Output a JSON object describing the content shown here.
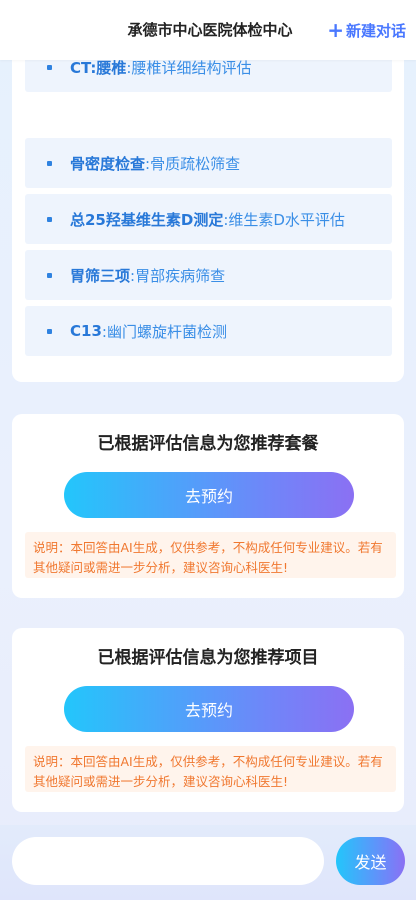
{
  "header": {
    "title": "承德市中心医院体检中心",
    "new_chat_icon": "plus-icon",
    "new_chat_label": "新建对话"
  },
  "items": [
    {
      "name": "CT:腰椎",
      "desc": ":腰椎详细结构评估"
    },
    {
      "name": "骨密度检查",
      "desc": ":骨质疏松筛查"
    },
    {
      "name": "总25羟基维生素D测定",
      "desc": ":维生素D水平评估"
    },
    {
      "name": "胃筛三项",
      "desc": ":胃部疾病筛查"
    },
    {
      "name": "C13",
      "desc": ":幽门螺旋杆菌检测"
    }
  ],
  "recommend_package": {
    "title": "已根据评估信息为您推荐套餐",
    "button": "去预约",
    "notice": "说明：本回答由AI生成，仅供参考，不构成任何专业建议。若有其他疑问或需进一步分析，建议咨询心科医生!"
  },
  "recommend_item": {
    "title": "已根据评估信息为您推荐项目",
    "button": "去预约",
    "notice": "说明：本回答由AI生成，仅供参考，不构成任何专业建议。若有其他疑问或需进一步分析，建议咨询心科医生!"
  },
  "input": {
    "value": "",
    "placeholder": ""
  },
  "send_label": "发送",
  "colors": {
    "accent": "#4a78ff",
    "item_text": "#2878d8",
    "notice_text": "#f07830",
    "notice_bg": "#fff4ec",
    "gradient_start": "#23c6fb",
    "gradient_end": "#8b70f3"
  }
}
